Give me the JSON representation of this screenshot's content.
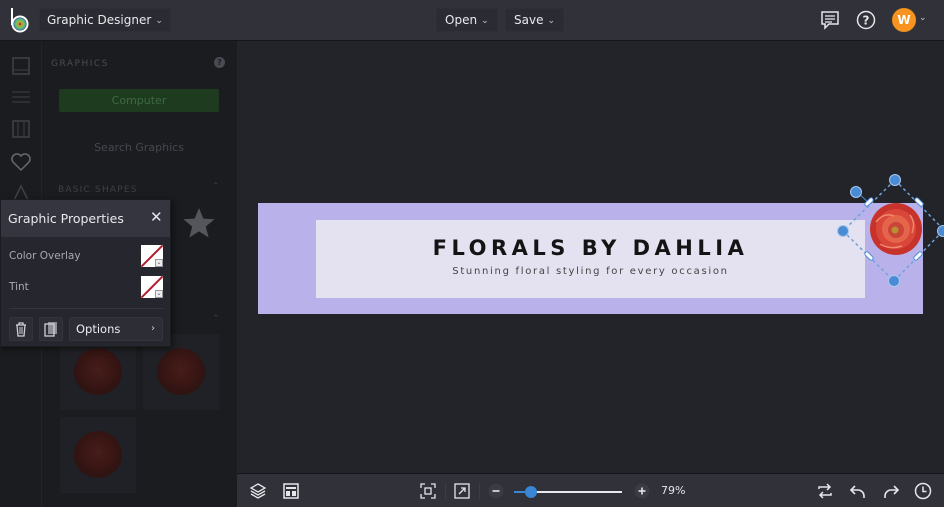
{
  "topbar": {
    "app_menu_label": "Graphic Designer",
    "open_label": "Open",
    "save_label": "Save",
    "user_initial": "W",
    "accent_color": "#f7931e"
  },
  "sidebar": {
    "rail_icons": [
      "image-icon",
      "sliders-icon",
      "columns-icon",
      "heart-icon",
      "shapes-icon"
    ],
    "panel_title": "GRAPHICS",
    "computer_button": "Computer",
    "search_button": "Search Graphics",
    "section_label": "BASIC SHAPES"
  },
  "graphic_properties": {
    "title": "Graphic Properties",
    "rows": [
      {
        "label": "Color Overlay"
      },
      {
        "label": "Tint"
      }
    ],
    "options_label": "Options"
  },
  "canvas": {
    "title": "FLORALS BY DAHLIA",
    "subtitle": "Stunning floral styling for every occasion",
    "banner_color": "#b9b2ea",
    "inner_color": "#e4e1f0"
  },
  "bottombar": {
    "zoom_percent": 79,
    "zoom_label": "79%",
    "zoom_slider_fraction": 0.16
  }
}
